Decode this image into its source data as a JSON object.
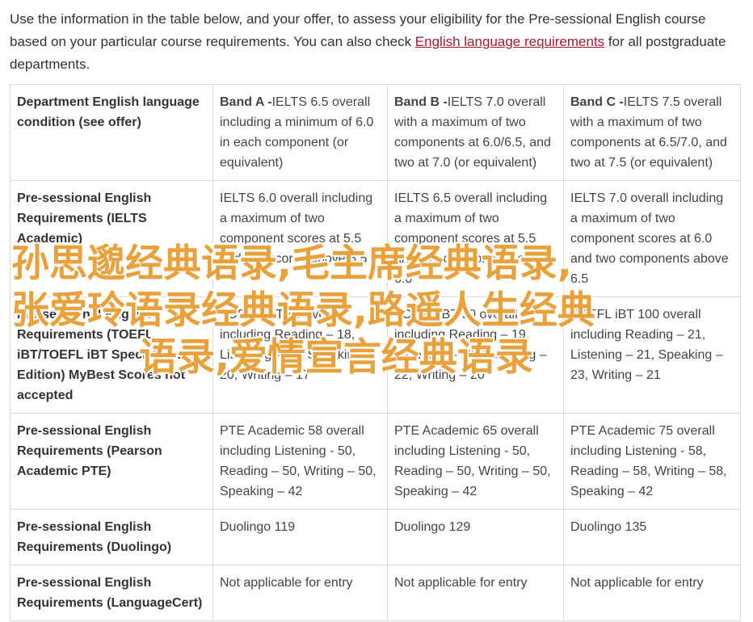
{
  "intro": {
    "text_before": "Use the information in the table below, and your offer, to assess your eligibility for the Pre-sessional English course based on your particular course requirements. You can also check ",
    "link": "English language requirements",
    "text_after": " for all postgraduate departments."
  },
  "table": {
    "header": {
      "col0": "Department English language condition (see offer)",
      "bandA_label": "Band A -",
      "bandA_text": "IELTS 6.5 overall including a minimum of 6.0 in each component (or equivalent)",
      "bandB_label": "Band B -",
      "bandB_text": "IELTS 7.0 overall with a maximum of two components at 6.0/6.5, and two at 7.0 (or equivalent)",
      "bandC_label": "Band C -",
      "bandC_text": "IELTS 7.5 overall with a maximum of two components at 6.5/7.0, and two at 7.5 (or equivalent)"
    },
    "rows": [
      {
        "head": "Pre-sessional English Requirements (IELTS Academic)",
        "a": "IELTS 6.0 overall including a maximum of two component scores at 5.5 and two scores above 5.5",
        "b": "IELTS 6.5 overall including a maximum of two component scores at 5.5 and two components above 6.0",
        "c": "IELTS 7.0 overall including a maximum of two component scores at 6.0 and two components above 6.5"
      },
      {
        "head": "Pre-sessional English Requirements (TOEFL iBT/TOEFL iBT Special Home Edition) MyBest Scores not accepted",
        "a": "TOEFL iBT 80 overall including Reading – 18, Listening – 17, Speaking – 20, Writing – 17",
        "b": "TOEFL iBT 90 overall including Reading – 19, Listening – 19, Speaking – 22, Writing – 20",
        "c": "TOEFL iBT 100 overall including Reading – 21, Listening – 21, Speaking – 23, Writing – 21"
      },
      {
        "head": "Pre-sessional English Requirements (Pearson Academic PTE)",
        "a": "PTE Academic 58 overall including Listening - 50, Reading – 50, Writing – 50, Speaking – 42",
        "b": "PTE Academic 65 overall including Listening - 50, Reading – 50, Writing – 50, Speaking – 42",
        "c": "PTE Academic 75 overall including Listening - 58, Reading – 58, Writing – 58, Speaking – 42"
      },
      {
        "head": "Pre-sessional English Requirements (Duolingo)",
        "a": "Duolingo 119",
        "b": "Duolingo 129",
        "c": "Duolingo 135"
      },
      {
        "head": "Pre-sessional English Requirements (LanguageCert)",
        "a": "Not applicable for entry",
        "b": "Not applicable for entry",
        "c": "Not applicable for entry"
      }
    ]
  },
  "overlay": {
    "line1": "孙思邈经典语录,毛主席经典语录,",
    "line2": "张爱玲语录经典语录,路遥人生经典",
    "line3": "语录,爱情宣言经典语录"
  },
  "colors": {
    "link": "#a6192e",
    "overlay": "#e8a13b",
    "border": "#d9d9d9"
  }
}
